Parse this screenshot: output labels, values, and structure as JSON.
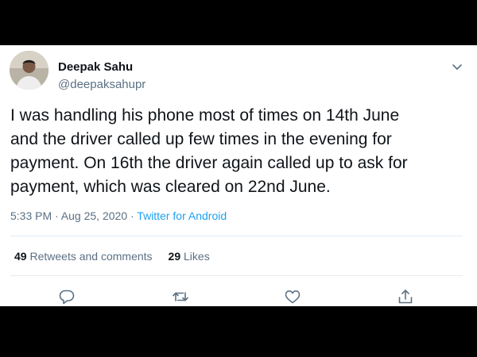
{
  "author": {
    "name": "Deepak Sahu",
    "handle": "@deepaksahupr"
  },
  "tweet": {
    "lines": [
      "I was handling his phone most of times on 14th June",
      "and the driver called up few times in the evening for",
      "payment. On 16th the driver again called up to ask for",
      "payment, which was cleared on 22nd June."
    ]
  },
  "meta": {
    "timestamp": "5:33 PM · Aug 25, 2020 · ",
    "source": "Twitter for Android"
  },
  "stats": {
    "retweets_count": "49",
    "retweets_label": "Retweets and comments",
    "likes_count": "29",
    "likes_label": "Likes"
  },
  "icons": {
    "more": "chevron-down-icon",
    "reply": "reply-icon",
    "retweet": "retweet-icon",
    "like": "heart-icon",
    "share": "share-icon"
  },
  "colors": {
    "text": "#0f1419",
    "secondary": "#5b7083",
    "accent": "#1da1f2",
    "divider": "#e6ecf0",
    "letterbox": "#000000"
  }
}
